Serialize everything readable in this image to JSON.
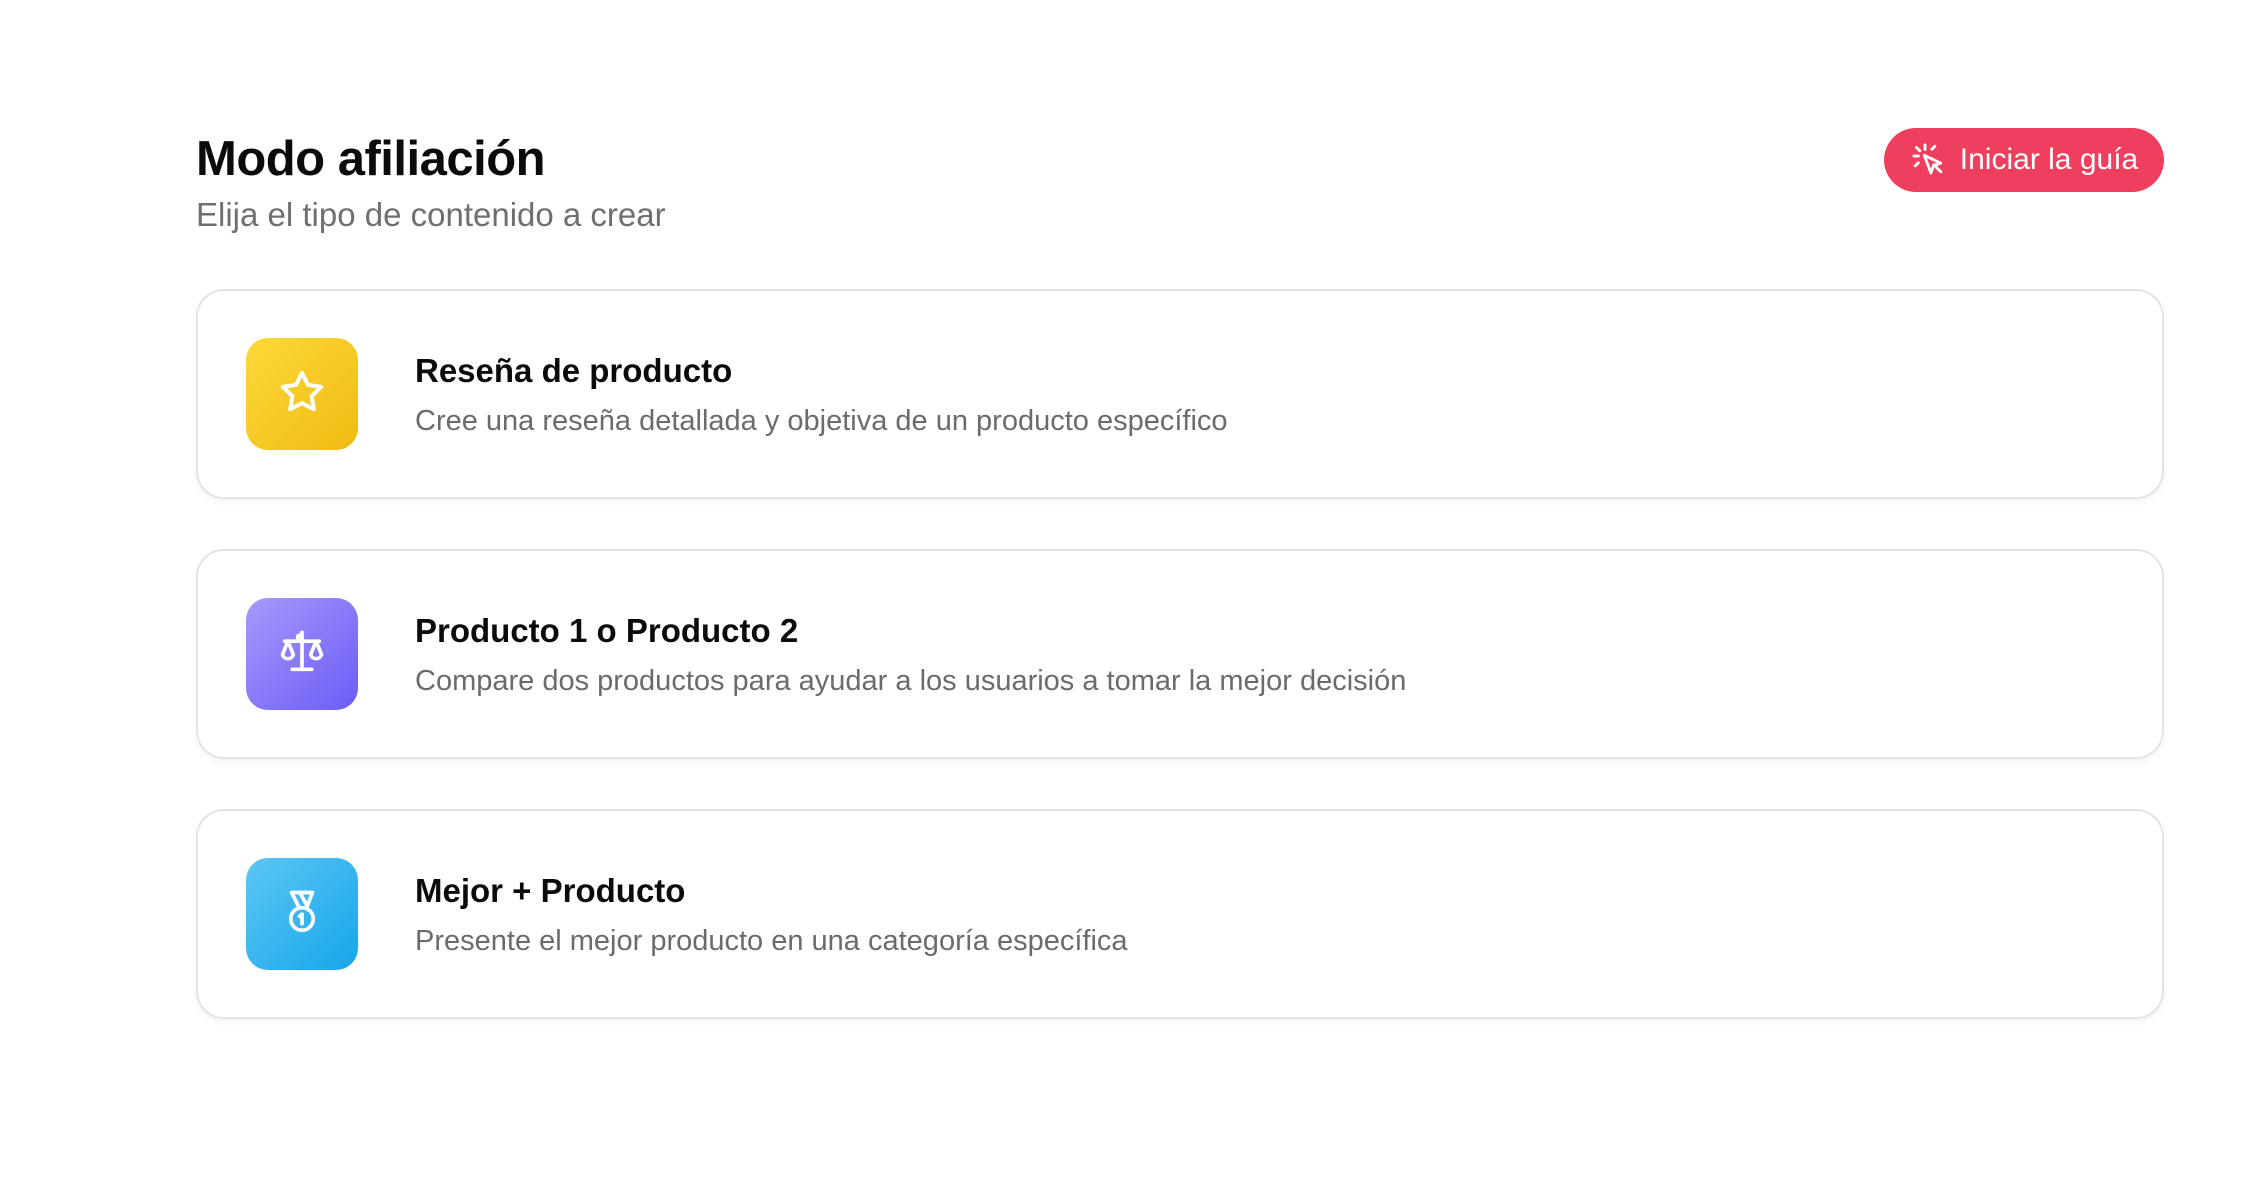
{
  "header": {
    "title": "Modo afiliación",
    "subtitle": "Elija el tipo de contenido a crear",
    "guide_button_label": "Iniciar la guía",
    "guide_button_icon": "pointer-click-icon"
  },
  "cards": [
    {
      "title": "Reseña de producto",
      "description": "Cree una reseña detallada y objetiva de un producto específico",
      "icon": "star-icon",
      "color": "#f5c41f"
    },
    {
      "title": "Producto 1 o Producto 2",
      "description": "Compare dos productos para ayudar a los usuarios a tomar la mejor decisión",
      "icon": "scale-icon",
      "color": "#7e6ff8"
    },
    {
      "title": "Mejor + Producto",
      "description": "Presente el mejor producto en una categoría específica",
      "icon": "medal-icon",
      "color": "#2cb1ee"
    }
  ],
  "colors": {
    "accent": "#ef3f5f",
    "border": "#e4e4e4",
    "muted_text": "#6b6b6b"
  }
}
